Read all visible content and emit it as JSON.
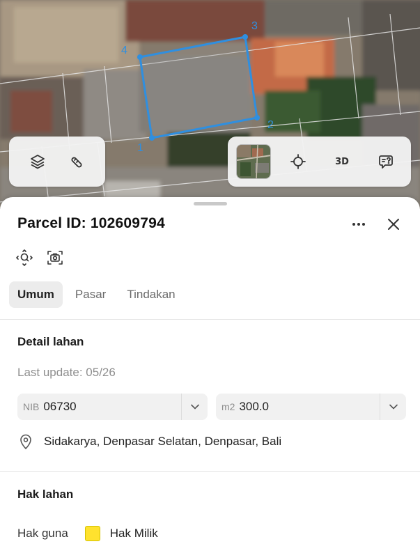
{
  "map": {
    "vertex_labels": [
      "1",
      "2",
      "3",
      "4"
    ],
    "left_tools": [
      {
        "icon": "layers-icon"
      },
      {
        "icon": "measure-icon"
      }
    ],
    "right_tools": [
      {
        "icon": "satellite-thumbnail"
      },
      {
        "icon": "locate-crosshair-icon"
      },
      {
        "icon": "3d-view-icon",
        "label": "3D"
      },
      {
        "icon": "feedback-chat-icon"
      }
    ],
    "parcel_outline_color": "#2f8fe0"
  },
  "sheet": {
    "title": "Parcel ID: 102609794",
    "tabs": [
      {
        "label": "Umum",
        "active": true
      },
      {
        "label": "Pasar",
        "active": false
      },
      {
        "label": "Tindakan",
        "active": false
      }
    ],
    "land_detail": {
      "heading": "Detail lahan",
      "last_update": "Last update: 05/26",
      "nib": {
        "prefix": "NIB",
        "value": "06730"
      },
      "area": {
        "prefix": "m2",
        "value": "300.0"
      },
      "location": "Sidakarya, Denpasar Selatan, Denpasar, Bali"
    },
    "land_rights": {
      "heading": "Hak lahan",
      "label": "Hak guna",
      "value": "Hak Milik",
      "swatch_color": "#ffe22e"
    }
  }
}
